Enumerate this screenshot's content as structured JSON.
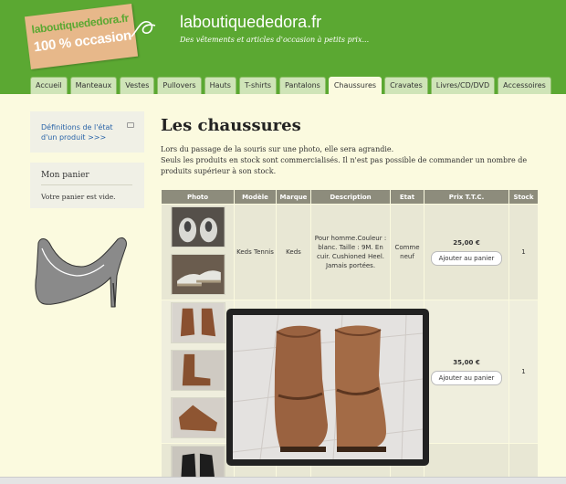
{
  "header": {
    "logo_line1": "laboutiquededora.fr",
    "logo_line2": "100 % occasion",
    "title": "laboutiquededora.fr",
    "tagline": "Des vêtements et articles d'occasion à petits prix..."
  },
  "tabs": [
    {
      "label": "Accueil",
      "active": false
    },
    {
      "label": "Manteaux",
      "active": false
    },
    {
      "label": "Vestes",
      "active": false
    },
    {
      "label": "Pullovers",
      "active": false
    },
    {
      "label": "Hauts",
      "active": false
    },
    {
      "label": "T-shirts",
      "active": false
    },
    {
      "label": "Pantalons",
      "active": false
    },
    {
      "label": "Chaussures",
      "active": true
    },
    {
      "label": "Cravates",
      "active": false
    },
    {
      "label": "Livres/CD/DVD",
      "active": false
    },
    {
      "label": "Accessoires",
      "active": false
    }
  ],
  "sidebar": {
    "definitions_link": "Définitions de l'état d'un produit >>>",
    "cart_title": "Mon panier",
    "cart_empty": "Votre panier est vide."
  },
  "main": {
    "title": "Les chaussures",
    "intro_line1": "Lors du passage de la souris sur une photo, elle sera agrandie.",
    "intro_line2": "Seuls les produits en stock sont commercialisés. Il n'est pas possible de commander un nombre de produits supérieur à son stock."
  },
  "table": {
    "headers": [
      "Photo",
      "Modèle",
      "Marque",
      "Description",
      "Etat",
      "Prix T.T.C.",
      "Stock"
    ],
    "rows": [
      {
        "model": "Keds Tennis",
        "brand": "Keds",
        "description": "Pour homme.Couleur : blanc. Taille : 9M. En cuir. Cushioned Heel. Jamais portées.",
        "state": "Comme neuf",
        "price": "25,00 €",
        "button": "Ajouter au panier",
        "stock": "1"
      },
      {
        "model": "",
        "brand": "",
        "description": "",
        "state": "",
        "price": "35,00 €",
        "button": "Ajouter au panier",
        "stock": "1"
      },
      {
        "model": "",
        "brand": "",
        "description": "",
        "state": "",
        "price": "",
        "button": "",
        "stock": ""
      }
    ]
  },
  "colors": {
    "header_green": "#5ba832",
    "page_bg": "#fbfadf",
    "table_header": "#8d8c7c",
    "link_blue": "#2a64a8"
  }
}
